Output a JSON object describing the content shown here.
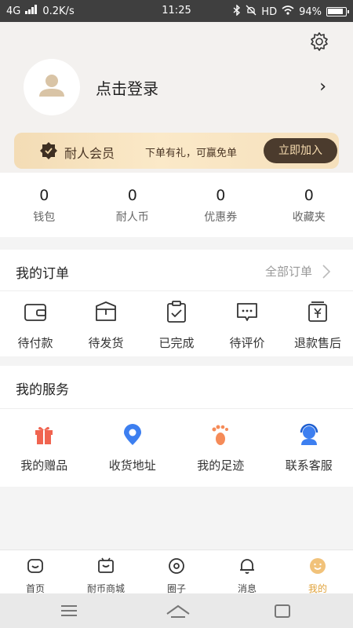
{
  "status": {
    "network": "4G",
    "speed": "0.2K/s",
    "time": "11:25",
    "hd": "HD",
    "battery": "94%"
  },
  "header": {
    "login": "点击登录"
  },
  "vip": {
    "name": "耐人会员",
    "promo": "下单有礼，可赢免单",
    "join": "立即加入"
  },
  "stats": [
    {
      "value": "0",
      "label": "钱包"
    },
    {
      "value": "0",
      "label": "耐人币"
    },
    {
      "value": "0",
      "label": "优惠券"
    },
    {
      "value": "0",
      "label": "收藏夹"
    }
  ],
  "orders": {
    "title": "我的订单",
    "all": "全部订单",
    "items": [
      {
        "label": "待付款",
        "icon": "wallet-icon"
      },
      {
        "label": "待发货",
        "icon": "box-icon"
      },
      {
        "label": "已完成",
        "icon": "clipboard-check-icon"
      },
      {
        "label": "待评价",
        "icon": "comment-icon"
      },
      {
        "label": "退款售后",
        "icon": "refund-icon"
      }
    ]
  },
  "services": {
    "title": "我的服务",
    "items": [
      {
        "label": "我的赠品",
        "icon": "gift-icon",
        "color": "#f06450"
      },
      {
        "label": "收货地址",
        "icon": "location-icon",
        "color": "#3d7ff0"
      },
      {
        "label": "我的足迹",
        "icon": "footprint-icon",
        "color": "#f58b58"
      },
      {
        "label": "联系客服",
        "icon": "support-icon",
        "color": "#3d7ff0"
      }
    ]
  },
  "tabs": [
    {
      "label": "首页",
      "icon": "home-icon"
    },
    {
      "label": "耐币商城",
      "icon": "mall-icon"
    },
    {
      "label": "圈子",
      "icon": "circle-icon"
    },
    {
      "label": "消息",
      "icon": "bell-icon"
    },
    {
      "label": "我的",
      "icon": "profile-icon",
      "active": true
    }
  ],
  "colors": {
    "accent": "#e0a23a",
    "vip_button": "#4b3b2d"
  }
}
